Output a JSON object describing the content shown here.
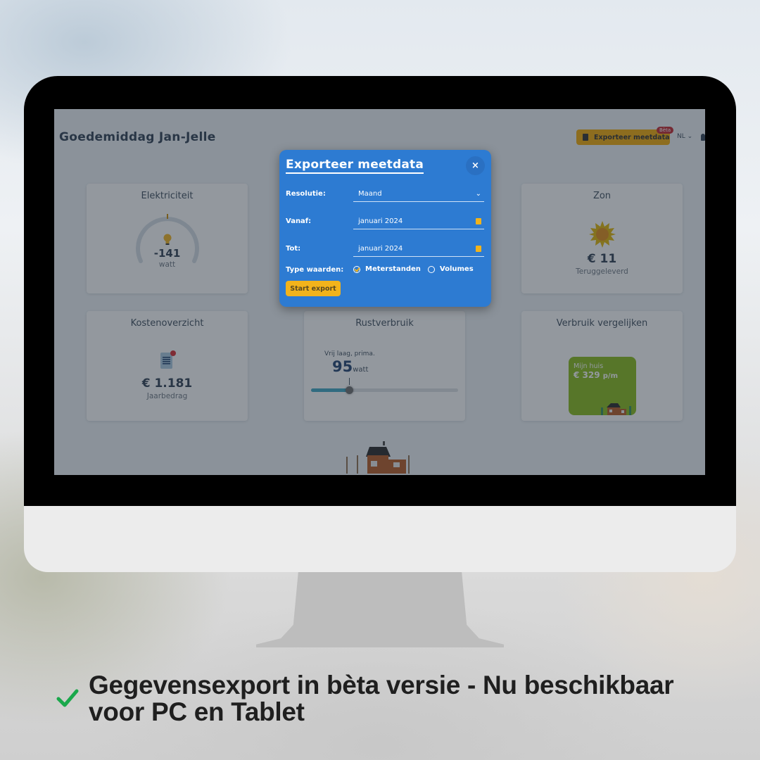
{
  "dashboard": {
    "greeting": "Goedemiddag Jan-Jelle",
    "export_button": "Exporteer meetdata",
    "beta_badge": "Bèta",
    "language": "NL",
    "cards": {
      "elektriciteit": {
        "title": "Elektriciteit",
        "value": "-141",
        "unit": "watt"
      },
      "zon": {
        "title": "Zon",
        "value": "€ 11",
        "label": "Teruggeleverd"
      },
      "kosten": {
        "title": "Kostenoverzicht",
        "value": "€ 1.181",
        "label": "Jaarbedrag"
      },
      "rust": {
        "title": "Rustverbruik",
        "comment": "Vrij laag, prima.",
        "value": "95",
        "unit": "watt",
        "slider_fraction": 0.26
      },
      "vergelijken": {
        "title": "Verbruik vergelijken",
        "tile_label": "Mijn huis",
        "tile_value": "€ 329",
        "tile_unit": "p/m"
      }
    }
  },
  "modal": {
    "title": "Exporteer meetdata",
    "close": "×",
    "resolutie_label": "Resolutie:",
    "resolutie_value": "Maand",
    "vanaf_label": "Vanaf:",
    "vanaf_value": "januari 2024",
    "tot_label": "Tot:",
    "tot_value": "januari 2024",
    "type_label": "Type waarden:",
    "options": [
      "Meterstanden",
      "Volumes"
    ],
    "selected_option": "Meterstanden",
    "start_button": "Start export"
  },
  "caption": {
    "line1": "Gegevensexport in bèta versie - Nu beschikbaar",
    "line2": "voor PC en Tablet"
  },
  "colors": {
    "modal_bg": "#2d7bd2",
    "accent_yellow": "#f2b31b",
    "beta_red": "#c2232b",
    "compare_green": "#86bb14",
    "check_green": "#1aa84b"
  }
}
